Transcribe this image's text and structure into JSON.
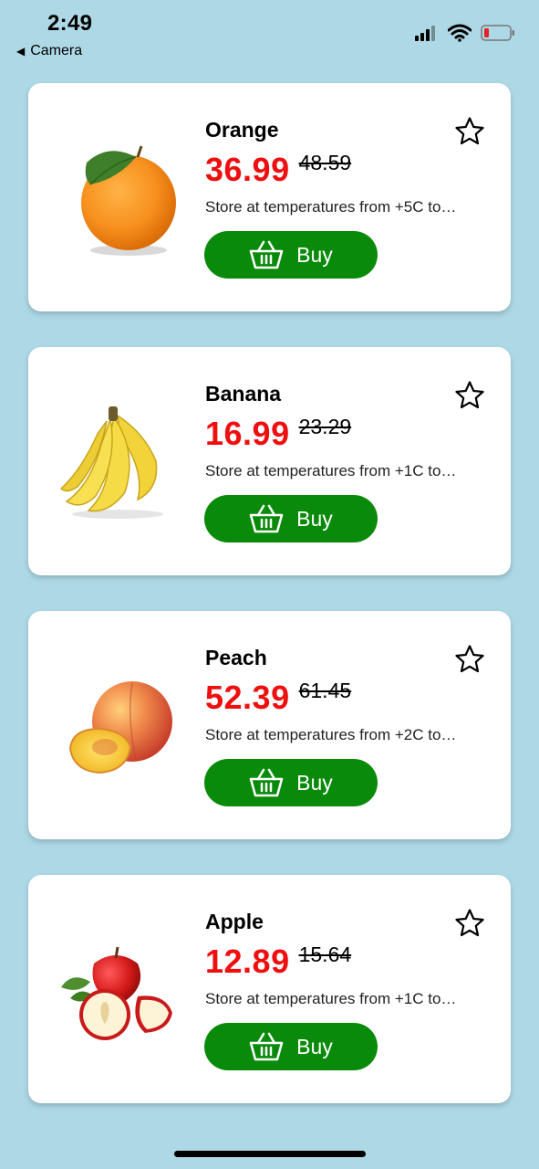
{
  "status_bar": {
    "time": "2:49",
    "back_label": "Camera",
    "icons": [
      "cellular-signal-icon",
      "wifi-icon",
      "battery-low-icon"
    ]
  },
  "colors": {
    "background": "#add8e6",
    "price": "#ee0f0f",
    "buy_button": "#0a8a0a"
  },
  "products": [
    {
      "name": "Orange",
      "price": "36.99",
      "old_price": "48.59",
      "description": "Store at temperatures from +5C to…",
      "buy_label": "Buy",
      "image": "orange-image"
    },
    {
      "name": "Banana",
      "price": "16.99",
      "old_price": "23.29",
      "description": "Store at temperatures from +1C to…",
      "buy_label": "Buy",
      "image": "banana-image"
    },
    {
      "name": "Peach",
      "price": "52.39",
      "old_price": "61.45",
      "description": "Store at temperatures from +2C to…",
      "buy_label": "Buy",
      "image": "peach-image"
    },
    {
      "name": "Apple",
      "price": "12.89",
      "old_price": "15.64",
      "description": "Store at temperatures from +1C to…",
      "buy_label": "Buy",
      "image": "apple-image"
    }
  ]
}
